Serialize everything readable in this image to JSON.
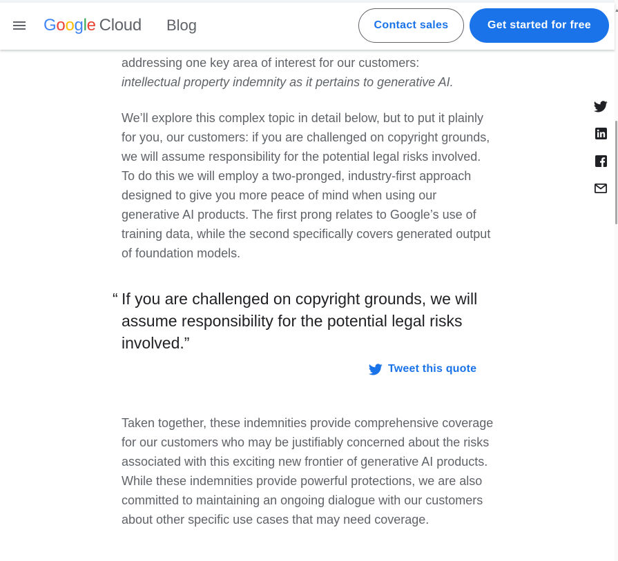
{
  "header": {
    "logo": {
      "letters": [
        "G",
        "o",
        "o",
        "g",
        "l",
        "e"
      ],
      "product": "Cloud"
    },
    "section": "Blog",
    "contact_sales_label": "Contact sales",
    "get_started_label": "Get started for free",
    "menu_icon": "hamburger-menu-icon"
  },
  "article": {
    "p1_line1": "addressing one key area of interest for our customers:",
    "p1_italic": "intellectual property indemnity as it pertains to generative AI.",
    "p2": "We’ll explore this complex topic in detail below, but to put it plainly for you, our customers: if you are challenged on copyright grounds, we will assume responsibility for the potential legal risks involved. To do this we will employ a two-pronged, industry-first approach designed to give you more peace of mind when using our generative AI products. The first prong relates to Google’s use of training data, while the second specifically covers generated output of foundation models.",
    "quote": {
      "open_mark": "“",
      "text": "If you are challenged on copyright grounds, we will assume responsibility for the potential legal risks involved.”",
      "tweet_label": "Tweet this quote"
    },
    "p3": "Taken together, these indemnities provide comprehensive coverage for our customers who may be justifiably concerned about the risks associated with this exciting new frontier of generative AI products. While these indemnities provide powerful protections, we are also committed to maintaining an ongoing dialogue with our customers about other specific use cases that may need coverage."
  },
  "share": {
    "icons": [
      "twitter-icon",
      "linkedin-icon",
      "facebook-icon",
      "email-icon"
    ]
  },
  "colors": {
    "brand_blue": "#1a73e8",
    "text_body": "#5f6368",
    "text_quote": "#202124"
  }
}
